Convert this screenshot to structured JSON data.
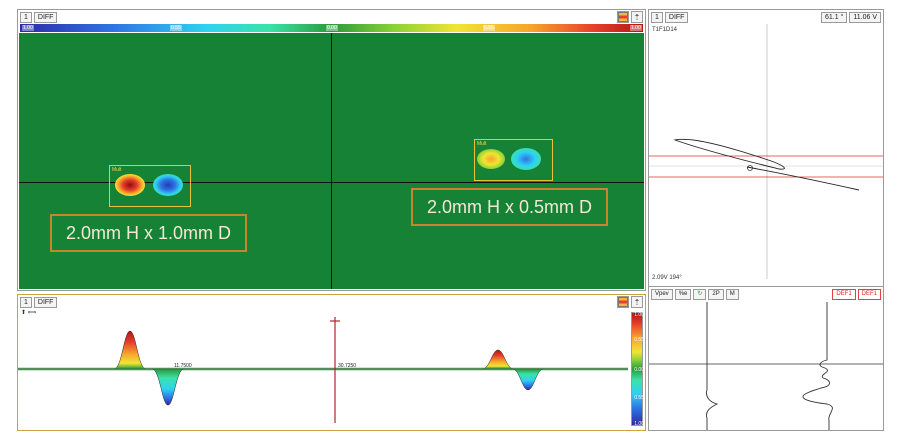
{
  "cscan_panel": {
    "channel": "1",
    "mode": "DIFF",
    "colorbar_ticks": [
      "1.00",
      "0.55",
      "0.00",
      "0.55",
      "1.00"
    ],
    "left_defect": {
      "roi_label": "Mult",
      "annotation": "2.0mm H x 1.0mm D"
    },
    "right_defect": {
      "roi_label": "Mult",
      "annotation": "2.0mm H x 0.5mm D"
    }
  },
  "strip_panel": {
    "channel": "1",
    "mode": "DIFF",
    "top_icons": "⬆ ⟺",
    "position_labels": [
      "11.7500",
      "30.7250"
    ],
    "colorbar_ticks": [
      "1.00",
      "0.55",
      "0.00",
      "0.55",
      "1.00"
    ],
    "trace_peaks": {
      "left_positive": 1.0,
      "left_negative": -0.95,
      "right_positive": 0.5,
      "right_negative": -0.55
    }
  },
  "lissajous_panel": {
    "channel": "1",
    "mode": "DIFF",
    "angle_readout": "61.1 °",
    "voltage_readout": "11.06 V",
    "channel_name": "T1F1D14",
    "signal_readout": "2.09V 194°"
  },
  "trace_panel": {
    "buttons": [
      "Vpev",
      "%e",
      "↻",
      "2P",
      "M"
    ],
    "def_buttons": [
      "DEF1",
      "DEF1"
    ]
  },
  "colors": {
    "scan_green": "#158236",
    "annotation_orange": "#c8852d",
    "roi_yellow": "#e8c23a",
    "red_line": "#d33"
  }
}
